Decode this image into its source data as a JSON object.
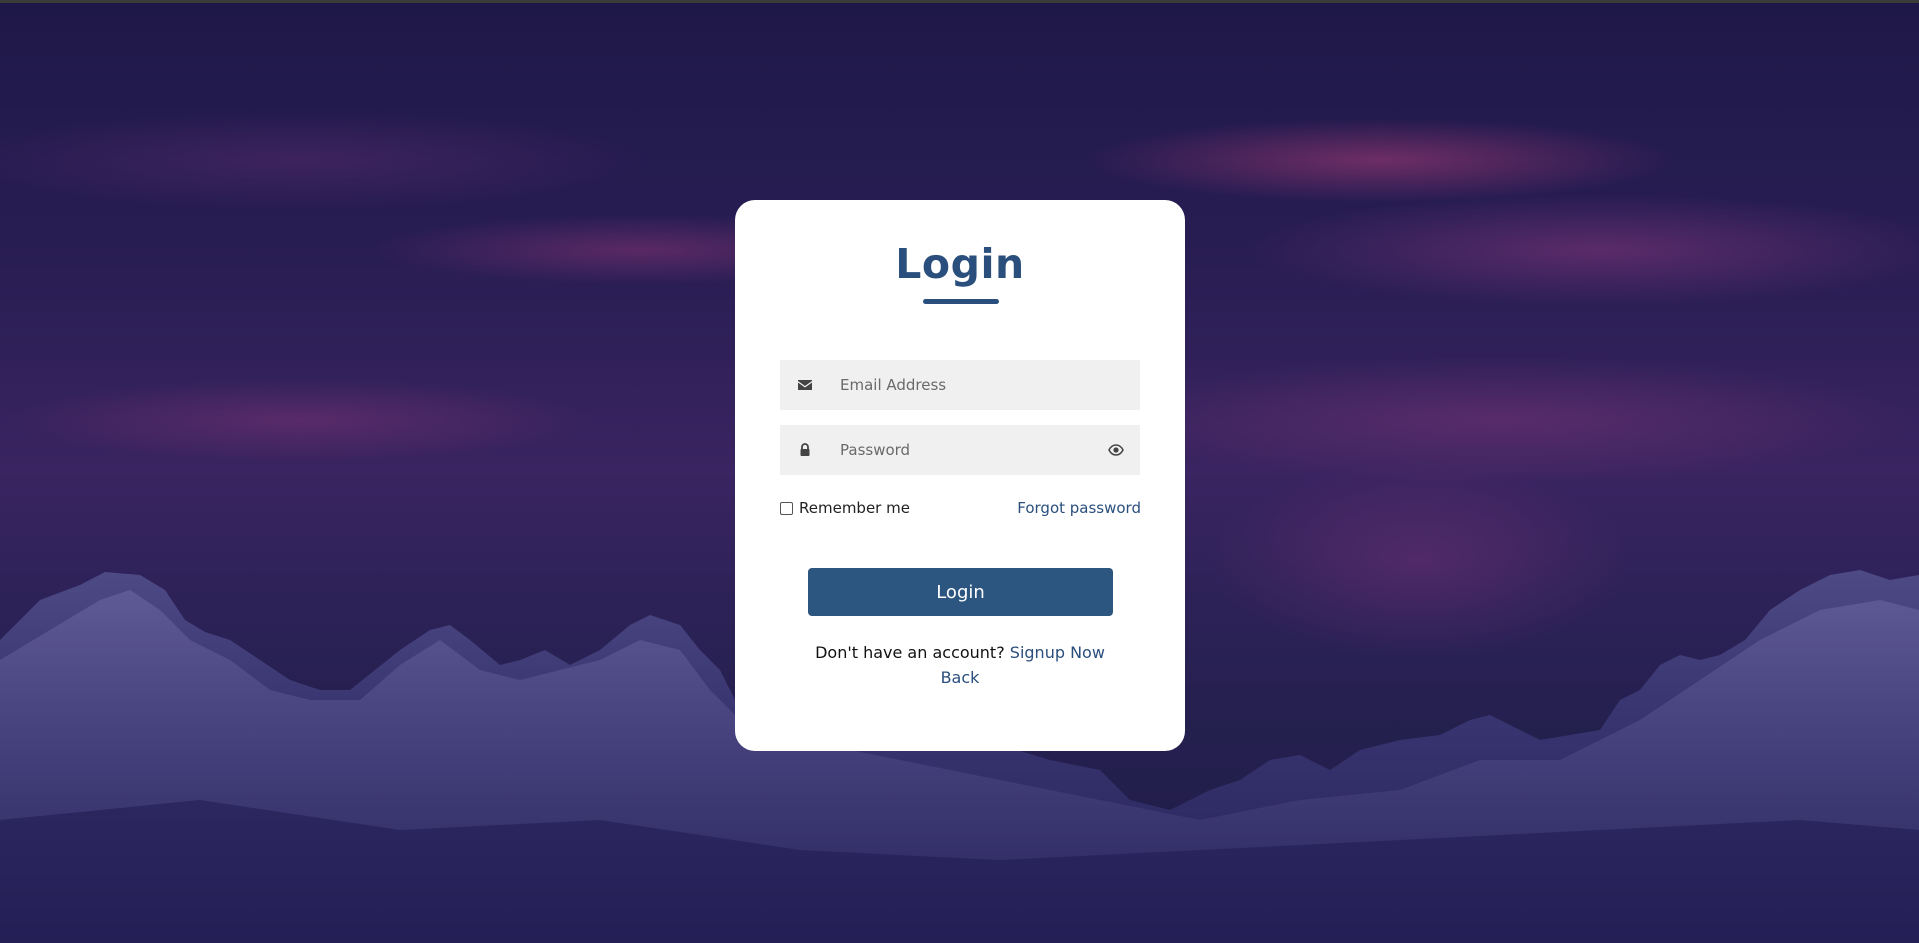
{
  "login_card": {
    "title": "Login",
    "email": {
      "placeholder": "Email Address",
      "value": "",
      "icon": "envelope-icon"
    },
    "password": {
      "placeholder": "Password",
      "value": "",
      "icon": "lock-icon",
      "toggle_icon": "eye-icon"
    },
    "remember_label": "Remember me",
    "remember_checked": false,
    "forgot_label": "Forgot password",
    "submit_label": "Login",
    "signup_prompt": "Don't have an account?",
    "signup_link": "Signup Now",
    "back_link": "Back"
  },
  "colors": {
    "accent": "#2a4f7d",
    "button": "#2c5680",
    "field_bg": "#f0f0f0",
    "card_bg": "#ffffff"
  }
}
